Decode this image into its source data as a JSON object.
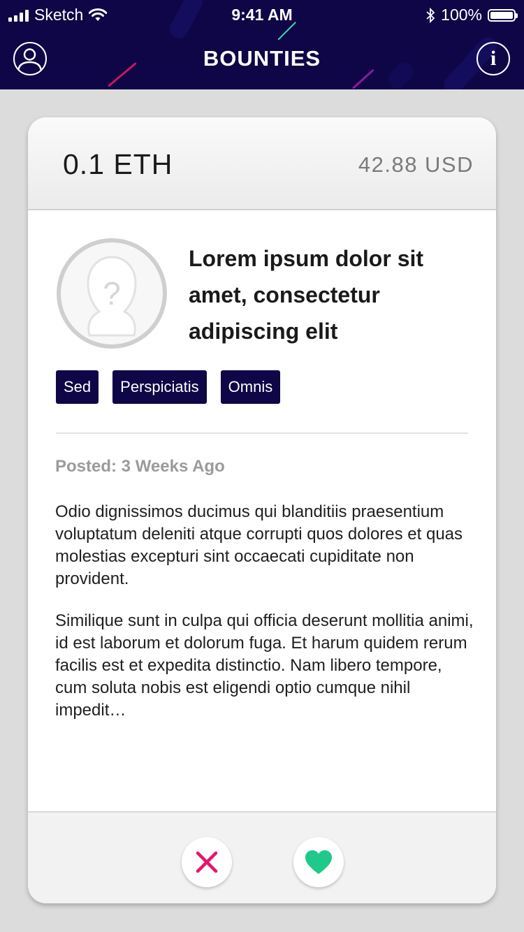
{
  "status_bar": {
    "carrier": "Sketch",
    "time": "9:41 AM",
    "battery": "100%",
    "battery_level": 1.0
  },
  "nav": {
    "title": "BOUNTIES",
    "profile_icon": "user-circle-icon",
    "info_icon": "info-circle-icon",
    "info_glyph": "i"
  },
  "card": {
    "amount": "0.1 ETH",
    "usd_value": "42.88 USD",
    "title": "Lorem ipsum dolor sit amet, consectetur adipiscing elit",
    "avatar_icon": "unknown-user-icon",
    "tags": [
      "Sed",
      "Perspiciatis",
      "Omnis"
    ],
    "posted": "Posted: 3 Weeks Ago",
    "description": [
      "Odio dignissimos ducimus qui blanditiis praesentium voluptatum deleniti atque corrupti quos dolores et quas molestias excepturi sint occaecati cupiditate non provident.",
      "Similique sunt in culpa qui officia deserunt mollitia animi, id est laborum et dolorum fuga. Et harum quidem rerum facilis est et expedita distinctio. Nam libero tempore, cum soluta nobis est eligendi optio cumque nihil impedit…"
    ]
  },
  "actions": {
    "reject_icon": "close-icon",
    "like_icon": "heart-icon"
  },
  "colors": {
    "header_bg": "#0e0646",
    "tag_bg": "#0e0646",
    "reject": "#e8146c",
    "like": "#1fc98a",
    "page_bg": "#dcdcdc"
  }
}
